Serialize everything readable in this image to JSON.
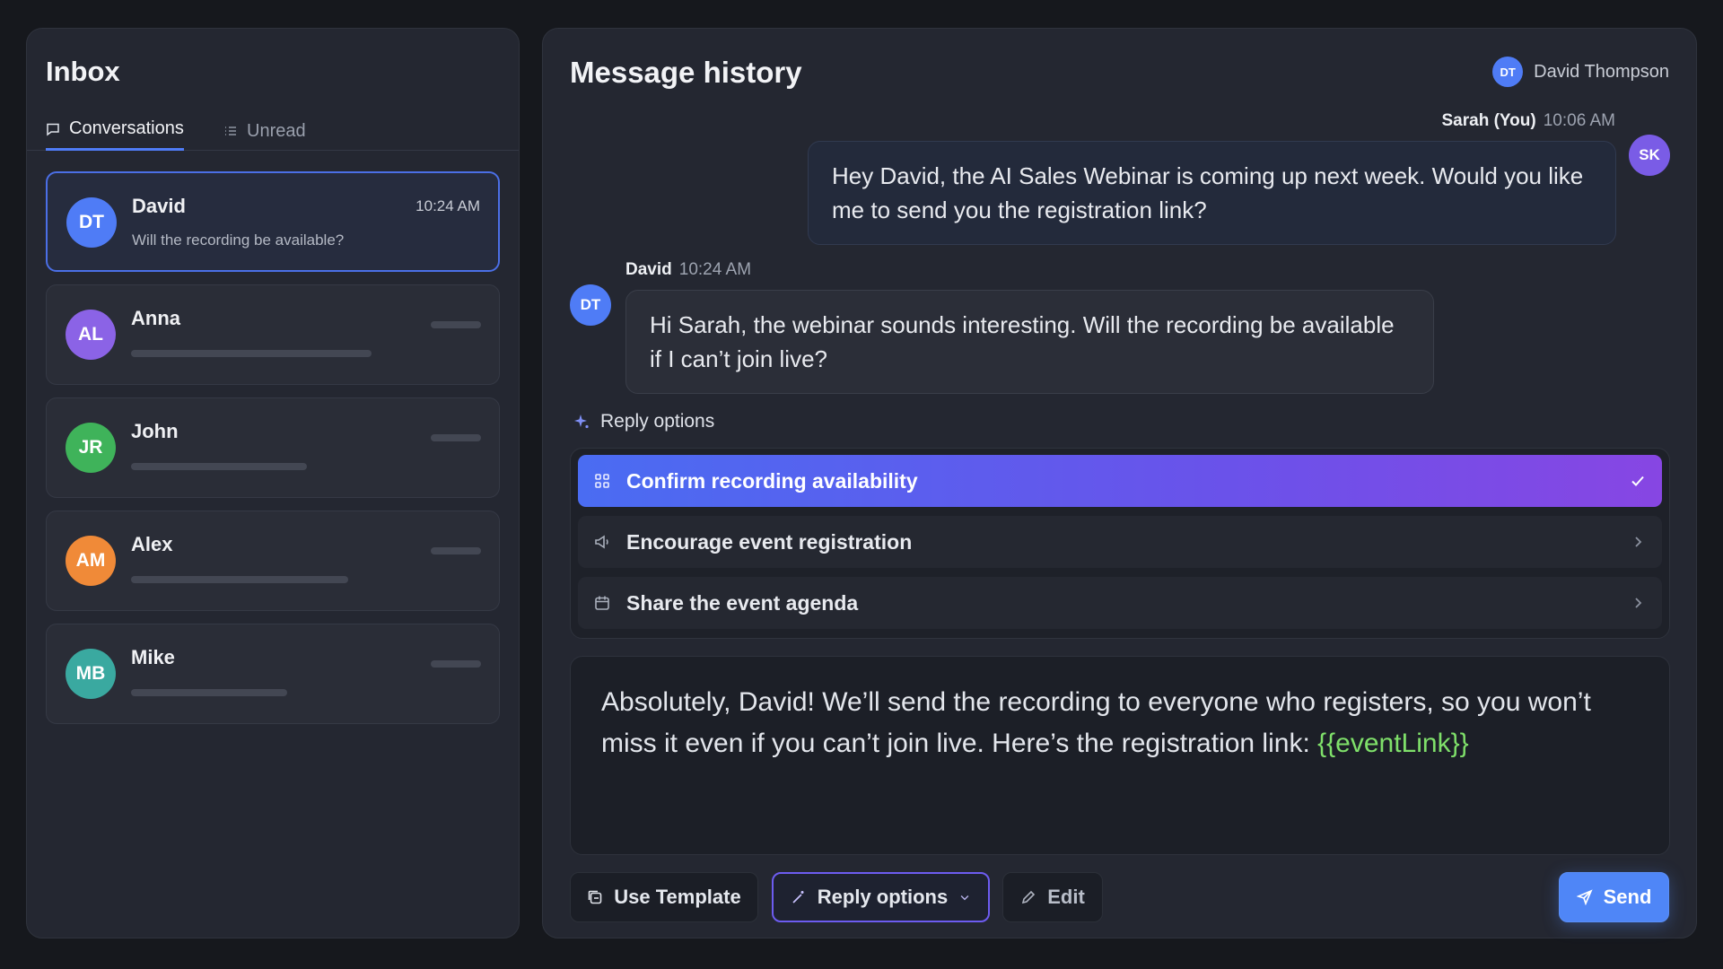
{
  "inbox": {
    "title": "Inbox",
    "tabs": [
      {
        "label": "Conversations",
        "icon": "chat-icon",
        "active": true
      },
      {
        "label": "Unread",
        "icon": "list-icon",
        "active": false
      }
    ],
    "conversations": [
      {
        "initials": "DT",
        "name": "David",
        "time": "10:24 AM",
        "preview": "Will the recording be available?",
        "color": "#4f7cf6",
        "active": true
      },
      {
        "initials": "AL",
        "name": "Anna",
        "color": "#8b63e6"
      },
      {
        "initials": "JR",
        "name": "John",
        "color": "#3fb35a"
      },
      {
        "initials": "AM",
        "name": "Alex",
        "color": "#f08a38"
      },
      {
        "initials": "MB",
        "name": "Mike",
        "color": "#3aa9a0"
      }
    ]
  },
  "history": {
    "title": "Message history",
    "contact": {
      "initials": "DT",
      "name": "David Thompson",
      "color": "#4f7cf6"
    },
    "messages": [
      {
        "sender": "Sarah (You)",
        "time": "10:06 AM",
        "initials": "SK",
        "color": "#7a5ce6",
        "text": "Hey David, the AI Sales Webinar is coming up next week. Would you like me to send you the registration link?"
      },
      {
        "sender": "David",
        "time": "10:24 AM",
        "initials": "DT",
        "color": "#4f7cf6",
        "text": "Hi Sarah, the webinar sounds interesting. Will the recording be available if I can’t join live?"
      }
    ],
    "reply_options": {
      "label": "Reply options",
      "items": [
        {
          "label": "Confirm recording availability",
          "icon": "grid-icon",
          "selected": true
        },
        {
          "label": "Encourage event registration",
          "icon": "megaphone-icon",
          "selected": false
        },
        {
          "label": "Share the event agenda",
          "icon": "calendar-icon",
          "selected": false
        }
      ]
    },
    "draft": {
      "text": "Absolutely, David! We’ll send the recording to everyone who registers, so you won’t miss it even if you can’t join live. Here’s the registration link: ",
      "token": "{{eventLink}}"
    },
    "toolbar": {
      "use_template": "Use Template",
      "reply_options": "Reply options",
      "edit": "Edit",
      "send": "Send"
    }
  }
}
